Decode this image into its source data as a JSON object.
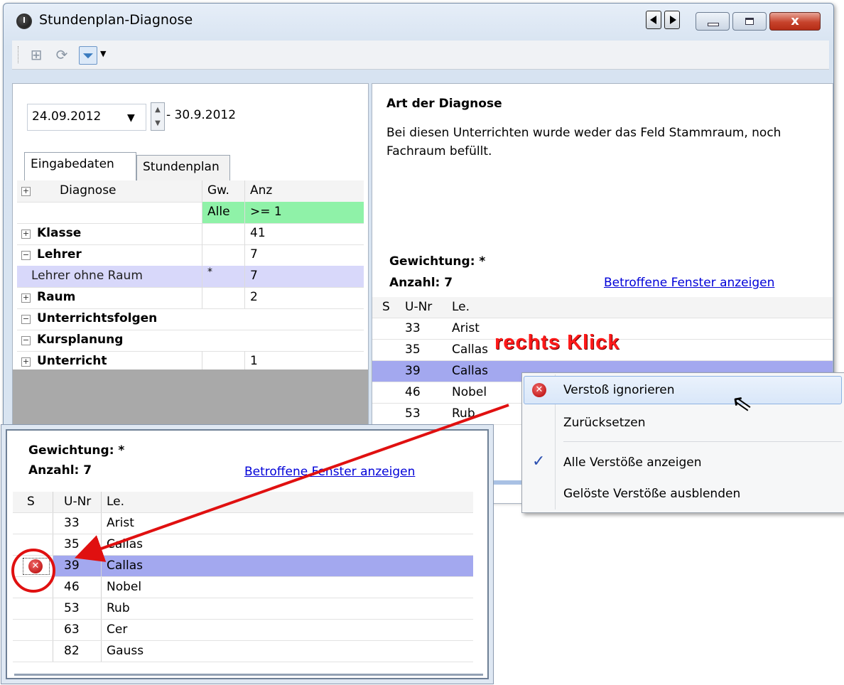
{
  "window": {
    "title": "Stundenplan-Diagnose",
    "controls": {
      "minimize": "–",
      "maximize": "▫",
      "close": "x"
    }
  },
  "toolbar": {
    "icons": [
      "grid-plus-icon",
      "refresh-icon",
      "filter-icon",
      "chevron-down-icon"
    ]
  },
  "left": {
    "date_start": "24.09.2012",
    "date_end": "- 30.9.2012",
    "tabs": [
      "Eingabedaten",
      "Stundenplan"
    ],
    "headers": {
      "diagnose": "Diagnose",
      "gw": "Gw.",
      "anz": "Anz"
    },
    "filter_row": {
      "gw": "Alle",
      "anz": ">= 1"
    },
    "rows": [
      {
        "label": "Klasse",
        "gw": "",
        "anz": "41",
        "expander": "⊞"
      },
      {
        "label": "Lehrer",
        "gw": "",
        "anz": "7",
        "expander": "⊟"
      },
      {
        "label": "Lehrer ohne Raum",
        "gw": "*",
        "anz": "7",
        "expander": ""
      },
      {
        "label": "Raum",
        "gw": "",
        "anz": "2",
        "expander": "⊞"
      },
      {
        "label": "Unterrichtsfolgen",
        "gw": "",
        "anz": "",
        "expander": "⊟"
      },
      {
        "label": "Kursplanung",
        "gw": "",
        "anz": "",
        "expander": "⊟"
      },
      {
        "label": "Unterricht",
        "gw": "",
        "anz": "1",
        "expander": "⊞"
      }
    ]
  },
  "right": {
    "art_title": "Art der Diagnose",
    "art_desc": "Bei diesen Unterrichten wurde weder das Feld Stammraum, noch Fachraum befüllt.",
    "gewichtung": "Gewichtung: *",
    "anzahl": "Anzahl: 7",
    "link": "Betroffene Fenster anzeigen",
    "headers": {
      "s": "S",
      "unr": "U-Nr",
      "le": "Le."
    },
    "rows": [
      {
        "unr": "33",
        "le": "Arist"
      },
      {
        "unr": "35",
        "le": "Callas"
      },
      {
        "unr": "39",
        "le": "Callas"
      },
      {
        "unr": "46",
        "le": "Nobel"
      },
      {
        "unr": "53",
        "le": "Rub"
      }
    ],
    "partial_text": "s"
  },
  "context_menu": {
    "items": [
      {
        "label": "Verstoß ignorieren",
        "icon": "error-icon"
      },
      {
        "label": "Zurücksetzen",
        "icon": ""
      },
      {
        "label": "Alle Verstöße anzeigen",
        "icon": "checkmark-icon"
      },
      {
        "label": "Gelöste Verstöße ausblenden",
        "icon": ""
      }
    ]
  },
  "annotation": {
    "text": "rechts Klick"
  },
  "zoom": {
    "gewichtung": "Gewichtung: *",
    "anzahl": "Anzahl: 7",
    "link": "Betroffene Fenster anzeigen",
    "headers": {
      "s": "S",
      "unr": "U-Nr",
      "le": "Le."
    },
    "rows": [
      {
        "unr": "33",
        "le": "Arist"
      },
      {
        "unr": "35",
        "le": "Callas"
      },
      {
        "unr": "39",
        "le": "Callas"
      },
      {
        "unr": "46",
        "le": "Nobel"
      },
      {
        "unr": "53",
        "le": "Rub"
      },
      {
        "unr": "63",
        "le": "Cer"
      },
      {
        "unr": "82",
        "le": "Gauss"
      }
    ]
  },
  "colors": {
    "selection": "#a3a8ef",
    "filter_row": "#8ff2a8",
    "lehrer_ohne_raum": "#d8d8fa",
    "annotation": "#ff1a1a"
  }
}
